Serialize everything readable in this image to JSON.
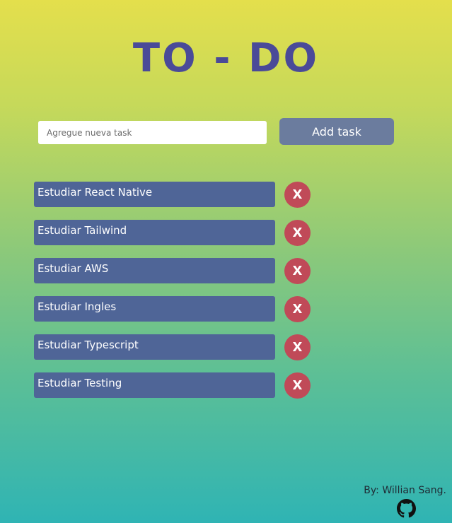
{
  "header": {
    "title": "TO - DO"
  },
  "form": {
    "input_placeholder": "Agregue nueva task",
    "input_value": "",
    "add_label": "Add task"
  },
  "tasks": [
    {
      "label": "Estudiar React Native",
      "delete_label": "X"
    },
    {
      "label": "Estudiar Tailwind",
      "delete_label": "X"
    },
    {
      "label": "Estudiar AWS",
      "delete_label": "X"
    },
    {
      "label": "Estudiar Ingles",
      "delete_label": "X"
    },
    {
      "label": "Estudiar Typescript",
      "delete_label": "X"
    },
    {
      "label": "Estudiar Testing",
      "delete_label": "X"
    }
  ],
  "footer": {
    "credit": "By: Willian Sang.",
    "link_icon": "github-icon"
  },
  "colors": {
    "title": "#4a4a98",
    "task_bg": "#4f6597",
    "delete_bg": "#c04a58",
    "add_button_bg": "#6b7c9e",
    "gradient_top": "#e4df4c",
    "gradient_bottom": "#2fb4b4"
  }
}
